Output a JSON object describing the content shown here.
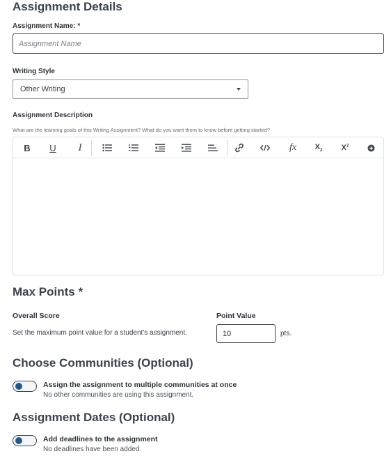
{
  "details": {
    "title": "Assignment Details",
    "name_label": "Assignment Name: *",
    "name_placeholder": "Assignment Name",
    "style_label": "Writing Style",
    "style_value": "Other Writing",
    "desc_label": "Assignment Description",
    "desc_hint": "What are the learning goals of this Writing Assignment? What do you want them to know before getting started?"
  },
  "toolbar": {
    "bold": "B",
    "underline": "U",
    "italic": "I",
    "formula": "fx",
    "subscript_base": "X",
    "subscript_mark": "2",
    "superscript_base": "X",
    "superscript_mark": "2"
  },
  "points": {
    "title": "Max Points *",
    "overall_label": "Overall Score",
    "overall_desc": "Set the maximum point value for a student's assignment.",
    "value_label": "Point Value",
    "value": "10",
    "unit": "pts."
  },
  "communities": {
    "title": "Choose Communities (Optional)",
    "toggle_title": "Assign the assignment to multiple communities at once",
    "toggle_sub": "No other communities are using this assignment."
  },
  "dates": {
    "title": "Assignment Dates (Optional)",
    "toggle_title": "Add deadlines to the assignment",
    "toggle_sub": "No deadlines have been added."
  }
}
